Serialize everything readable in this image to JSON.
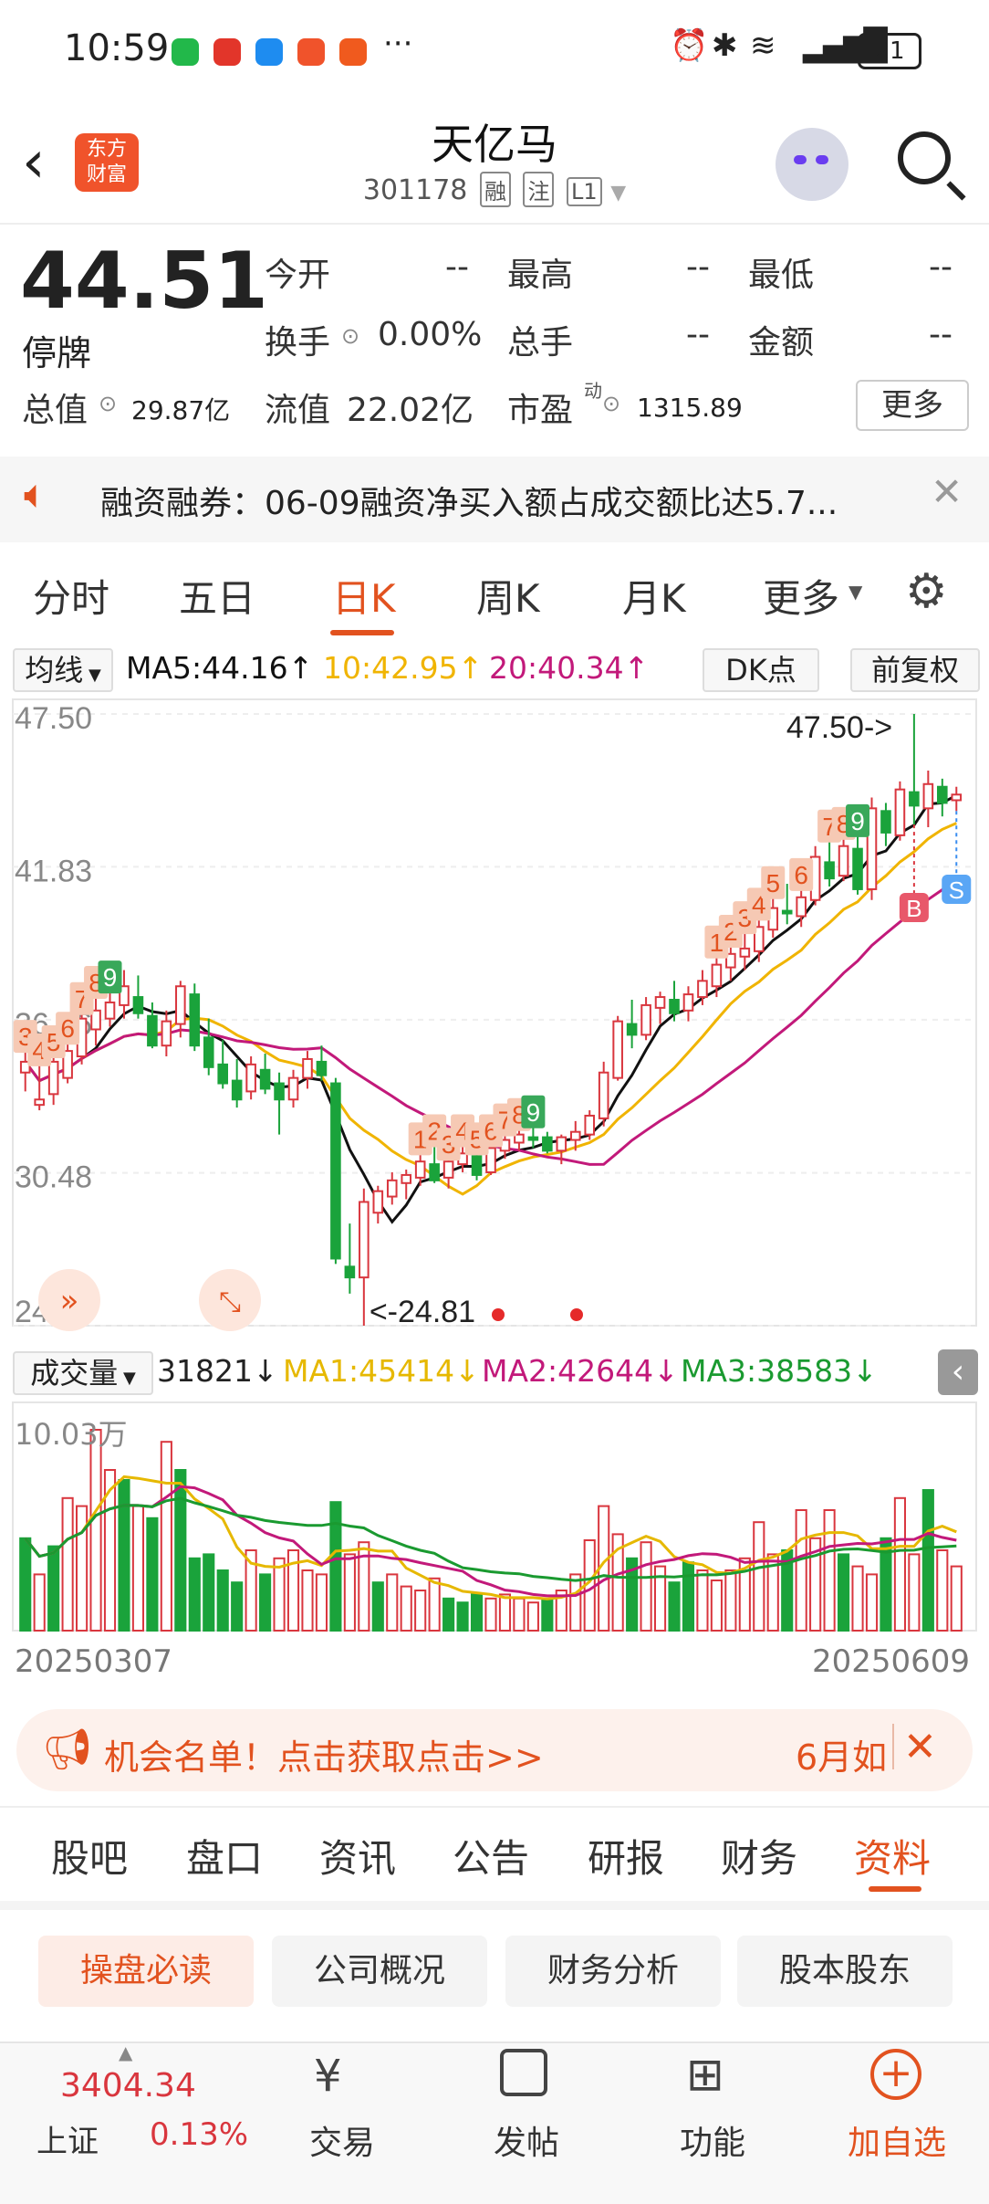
{
  "status_bar": {
    "time": "10:59",
    "battery": "21"
  },
  "header": {
    "title": "天亿马",
    "code": "301178",
    "tags": [
      "融",
      "注",
      "L1"
    ],
    "logo_text": "东方\n财富"
  },
  "quote": {
    "price": "44.51",
    "state": "停牌",
    "fields": [
      {
        "label": "今开",
        "value": "--"
      },
      {
        "label": "最高",
        "value": "--"
      },
      {
        "label": "最低",
        "value": "--"
      },
      {
        "label": "换手",
        "value": "0.00%"
      },
      {
        "label": "总手",
        "value": "--"
      },
      {
        "label": "金额",
        "value": "--"
      }
    ],
    "total_cap_label": "总值",
    "total_cap": "29.87亿",
    "float_cap_label": "流值",
    "float_cap": "22.02亿",
    "pe_label": "市盈",
    "pe_sup": "动",
    "pe": "1315.89",
    "more": "更多"
  },
  "notice": {
    "text": "融资融券：06-09融资净买入额占成交额比达5.7..."
  },
  "kline_tabs": [
    "分时",
    "五日",
    "日K",
    "周K",
    "月K",
    "更多"
  ],
  "chart_header": {
    "ma_select": "均线",
    "ma5": "MA5:44.16↑",
    "ma10": "10:42.95↑",
    "ma20": "20:40.34↑",
    "dk": "DK点",
    "adj": "前复权"
  },
  "colors": {
    "up": "#d9363e",
    "down": "#1aa33b",
    "accent": "#e2521f",
    "ma5": "#111111",
    "ma10": "#f0b400",
    "ma20": "#c2197a"
  },
  "chart_data": {
    "type": "candlestick",
    "y_ticks": [
      "47.50",
      "41.83",
      "36.16",
      "30.48",
      "24.81"
    ],
    "ylim": [
      24.81,
      47.5
    ],
    "x_labels": [
      "20250307",
      "20250609"
    ],
    "max_label": "47.50->",
    "min_label": "<-24.81",
    "ohlc": [
      [
        34.2,
        35.0,
        33.5,
        34.6
      ],
      [
        33.0,
        34.5,
        32.8,
        33.2
      ],
      [
        33.4,
        34.8,
        33.0,
        34.6
      ],
      [
        34.0,
        35.3,
        33.8,
        35.0
      ],
      [
        34.8,
        36.4,
        34.5,
        36.2
      ],
      [
        35.8,
        37.0,
        35.2,
        36.5
      ],
      [
        36.2,
        37.2,
        35.9,
        36.8
      ],
      [
        36.7,
        38.0,
        36.2,
        37.4
      ],
      [
        37.0,
        37.8,
        36.2,
        36.4
      ],
      [
        36.3,
        36.8,
        35.1,
        35.2
      ],
      [
        35.2,
        36.5,
        34.8,
        36.1
      ],
      [
        36.0,
        37.6,
        35.5,
        37.4
      ],
      [
        37.1,
        37.5,
        35.0,
        35.2
      ],
      [
        35.5,
        36.2,
        34.1,
        34.4
      ],
      [
        34.5,
        35.4,
        33.6,
        33.8
      ],
      [
        33.9,
        34.7,
        32.9,
        33.2
      ],
      [
        33.5,
        34.8,
        33.2,
        34.5
      ],
      [
        34.3,
        34.9,
        33.4,
        33.6
      ],
      [
        33.8,
        34.2,
        31.9,
        33.2
      ],
      [
        33.2,
        34.3,
        32.9,
        34.0
      ],
      [
        34.0,
        35.0,
        33.6,
        34.7
      ],
      [
        34.6,
        35.2,
        33.9,
        34.1
      ],
      [
        33.8,
        34.0,
        27.1,
        27.3
      ],
      [
        27.0,
        28.6,
        26.0,
        26.6
      ],
      [
        26.6,
        29.9,
        24.81,
        29.4
      ],
      [
        29.0,
        30.0,
        28.6,
        29.8
      ],
      [
        29.6,
        30.5,
        29.3,
        30.2
      ],
      [
        30.1,
        30.6,
        29.5,
        30.4
      ],
      [
        30.3,
        31.2,
        30.0,
        30.9
      ],
      [
        30.8,
        31.5,
        30.1,
        30.2
      ],
      [
        30.3,
        31.0,
        29.9,
        30.9
      ],
      [
        30.8,
        31.5,
        30.5,
        31.2
      ],
      [
        31.1,
        31.2,
        30.2,
        30.4
      ],
      [
        30.5,
        31.5,
        30.4,
        31.4
      ],
      [
        31.3,
        31.9,
        31.0,
        31.7
      ],
      [
        31.6,
        32.1,
        31.3,
        31.9
      ],
      [
        31.8,
        32.2,
        31.4,
        31.7
      ],
      [
        31.8,
        32.0,
        31.2,
        31.3
      ],
      [
        31.3,
        31.9,
        30.8,
        31.8
      ],
      [
        31.7,
        32.4,
        31.3,
        32.0
      ],
      [
        31.9,
        32.8,
        31.7,
        32.6
      ],
      [
        32.5,
        34.6,
        32.2,
        34.2
      ],
      [
        34.0,
        36.3,
        33.9,
        36.1
      ],
      [
        36.0,
        36.9,
        35.1,
        35.6
      ],
      [
        35.6,
        37.0,
        35.4,
        36.7
      ],
      [
        36.6,
        37.2,
        36.0,
        37.0
      ],
      [
        36.9,
        37.6,
        36.1,
        36.4
      ],
      [
        36.5,
        37.4,
        36.1,
        37.1
      ],
      [
        37.0,
        38.0,
        36.7,
        37.6
      ],
      [
        37.4,
        38.5,
        37.0,
        38.2
      ],
      [
        38.1,
        38.9,
        37.6,
        38.6
      ],
      [
        38.5,
        39.4,
        38.0,
        38.8
      ],
      [
        38.7,
        39.9,
        38.3,
        39.6
      ],
      [
        39.5,
        40.7,
        39.2,
        40.3
      ],
      [
        40.2,
        41.2,
        39.7,
        40.1
      ],
      [
        40.0,
        41.0,
        39.6,
        40.7
      ],
      [
        40.6,
        42.6,
        40.4,
        42.2
      ],
      [
        42.0,
        42.8,
        41.1,
        41.4
      ],
      [
        41.5,
        42.9,
        41.3,
        42.6
      ],
      [
        42.5,
        43.0,
        40.8,
        41.0
      ],
      [
        41.0,
        44.4,
        40.6,
        44.0
      ],
      [
        43.9,
        44.2,
        42.6,
        43.1
      ],
      [
        43.0,
        45.0,
        42.8,
        44.7
      ],
      [
        44.6,
        47.5,
        43.4,
        44.1
      ],
      [
        44.0,
        45.4,
        43.3,
        44.9
      ],
      [
        44.8,
        45.1,
        43.7,
        44.2
      ],
      [
        44.3,
        44.8,
        43.9,
        44.51
      ]
    ],
    "signals_visible": [
      "3",
      "4",
      "5",
      "6",
      "7",
      "8",
      "9",
      "1",
      "2",
      "3",
      "4",
      "5",
      "6",
      "7",
      "8",
      "9",
      "1",
      "2",
      "3",
      "4",
      "5",
      "6",
      "7",
      "8",
      "9"
    ],
    "buy_label": "B",
    "sell_label": "S"
  },
  "volume_header": {
    "select": "成交量",
    "vol": "31821↓",
    "ma1": "MA1:45414↓",
    "ma2": "MA2:42644↓",
    "ma3": "MA3:38583↓",
    "top": "10.03万"
  },
  "volume_data": [
    {
      "v": 0.46,
      "up": false
    },
    {
      "v": 0.28,
      "up": true
    },
    {
      "v": 0.42,
      "up": false
    },
    {
      "v": 0.66,
      "up": true
    },
    {
      "v": 0.62,
      "up": true
    },
    {
      "v": 1.0,
      "up": true
    },
    {
      "v": 0.8,
      "up": true
    },
    {
      "v": 0.75,
      "up": false
    },
    {
      "v": 0.62,
      "up": true
    },
    {
      "v": 0.56,
      "up": false
    },
    {
      "v": 0.94,
      "up": true
    },
    {
      "v": 0.8,
      "up": false
    },
    {
      "v": 0.36,
      "up": false
    },
    {
      "v": 0.38,
      "up": false
    },
    {
      "v": 0.3,
      "up": false
    },
    {
      "v": 0.24,
      "up": false
    },
    {
      "v": 0.4,
      "up": true
    },
    {
      "v": 0.28,
      "up": false
    },
    {
      "v": 0.36,
      "up": true
    },
    {
      "v": 0.4,
      "up": true
    },
    {
      "v": 0.3,
      "up": true
    },
    {
      "v": 0.28,
      "up": true
    },
    {
      "v": 0.64,
      "up": false
    },
    {
      "v": 0.38,
      "up": true
    },
    {
      "v": 0.44,
      "up": true
    },
    {
      "v": 0.24,
      "up": false
    },
    {
      "v": 0.28,
      "up": true
    },
    {
      "v": 0.22,
      "up": true
    },
    {
      "v": 0.2,
      "up": true
    },
    {
      "v": 0.26,
      "up": true
    },
    {
      "v": 0.16,
      "up": false
    },
    {
      "v": 0.14,
      "up": false
    },
    {
      "v": 0.18,
      "up": false
    },
    {
      "v": 0.16,
      "up": true
    },
    {
      "v": 0.18,
      "up": true
    },
    {
      "v": 0.16,
      "up": true
    },
    {
      "v": 0.14,
      "up": true
    },
    {
      "v": 0.15,
      "up": false
    },
    {
      "v": 0.2,
      "up": true
    },
    {
      "v": 0.28,
      "up": true
    },
    {
      "v": 0.45,
      "up": true
    },
    {
      "v": 0.62,
      "up": true
    },
    {
      "v": 0.48,
      "up": true
    },
    {
      "v": 0.36,
      "up": false
    },
    {
      "v": 0.44,
      "up": true
    },
    {
      "v": 0.32,
      "up": true
    },
    {
      "v": 0.24,
      "up": false
    },
    {
      "v": 0.34,
      "up": false
    },
    {
      "v": 0.3,
      "up": true
    },
    {
      "v": 0.25,
      "up": true
    },
    {
      "v": 0.3,
      "up": true
    },
    {
      "v": 0.36,
      "up": true
    },
    {
      "v": 0.54,
      "up": true
    },
    {
      "v": 0.38,
      "up": true
    },
    {
      "v": 0.4,
      "up": false
    },
    {
      "v": 0.6,
      "up": true
    },
    {
      "v": 0.46,
      "up": true
    },
    {
      "v": 0.6,
      "up": true
    },
    {
      "v": 0.38,
      "up": false
    },
    {
      "v": 0.32,
      "up": true
    },
    {
      "v": 0.28,
      "up": true
    },
    {
      "v": 0.46,
      "up": false
    },
    {
      "v": 0.66,
      "up": true
    },
    {
      "v": 0.38,
      "up": true
    },
    {
      "v": 0.7,
      "up": false
    },
    {
      "v": 0.4,
      "up": true
    },
    {
      "v": 0.32,
      "up": true
    }
  ],
  "banner": {
    "text": "机会名单！点击获取点击>>",
    "right": "6月如"
  },
  "sub_tabs": [
    "股吧",
    "盘口",
    "资讯",
    "公告",
    "研报",
    "财务",
    "资料"
  ],
  "pills": [
    "操盘必读",
    "公司概况",
    "财务分析",
    "股本股东"
  ],
  "tabbar": {
    "index_price": "3404.34",
    "index_name": "上证",
    "index_chg": "0.13%",
    "items": [
      "交易",
      "发帖",
      "功能",
      "加自选"
    ]
  }
}
